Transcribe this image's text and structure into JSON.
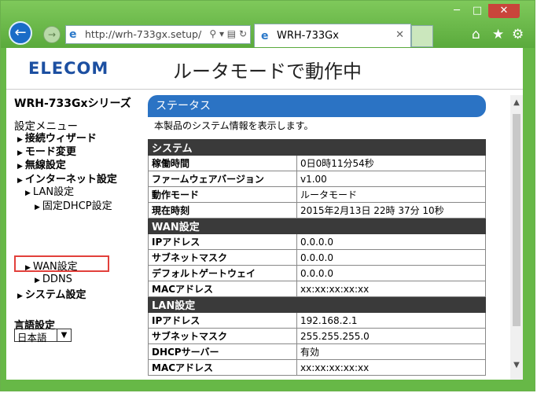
{
  "browser": {
    "url": "http://wrh-733gx.setup/",
    "tab_title": "WRH-733Gx",
    "tab_close": "✕",
    "addr_tools": "⚲ ▾ ▤ ↻",
    "win_min": "─",
    "win_max": "□",
    "win_close": "✕",
    "back_glyph": "←",
    "fwd_glyph": "→",
    "ie_glyph": "e",
    "home_glyph": "⌂",
    "star_glyph": "★",
    "gear_glyph": "⚙"
  },
  "header": {
    "logo": "ELECOM",
    "mode_title": "ルータモードで動作中"
  },
  "sidebar": {
    "series": "WRH-733Gxシリーズ",
    "menu_title": "設定メニュー",
    "items": [
      {
        "label": "接続ウィザード"
      },
      {
        "label": "モード変更"
      },
      {
        "label": "無線設定"
      },
      {
        "label": "インターネット設定"
      },
      {
        "label": "LAN設定"
      },
      {
        "label": "固定DHCP設定"
      },
      {
        "label": "WAN設定"
      },
      {
        "label": "DDNS"
      },
      {
        "label": "システム設定"
      }
    ],
    "tri": "▶",
    "lang_title": "言語設定",
    "lang_value": "日本語",
    "lang_arrow": "▼"
  },
  "main": {
    "status_title": "ステータス",
    "description": "本製品のシステム情報を表示します。",
    "sections": [
      {
        "title": "システム",
        "rows": [
          {
            "k": "稼働時間",
            "v": "0日0時11分54秒"
          },
          {
            "k": "ファームウェアバージョン",
            "v": "v1.00"
          },
          {
            "k": "動作モード",
            "v": "ルータモード"
          },
          {
            "k": "現在時刻",
            "v": "2015年2月13日 22時 37分 10秒"
          }
        ]
      },
      {
        "title": "WAN設定",
        "rows": [
          {
            "k": "IPアドレス",
            "v": "0.0.0.0"
          },
          {
            "k": "サブネットマスク",
            "v": "0.0.0.0"
          },
          {
            "k": "デフォルトゲートウェイ",
            "v": "0.0.0.0"
          },
          {
            "k": "MACアドレス",
            "v": "xx:xx:xx:xx:xx"
          }
        ]
      },
      {
        "title": "LAN設定",
        "rows": [
          {
            "k": "IPアドレス",
            "v": "192.168.2.1"
          },
          {
            "k": "サブネットマスク",
            "v": "255.255.255.0"
          },
          {
            "k": "DHCPサーバー",
            "v": "有効"
          },
          {
            "k": "MACアドレス",
            "v": "xx:xx:xx:xx:xx"
          }
        ]
      }
    ]
  },
  "scrollbar": {
    "up": "▲",
    "down": "▼"
  }
}
